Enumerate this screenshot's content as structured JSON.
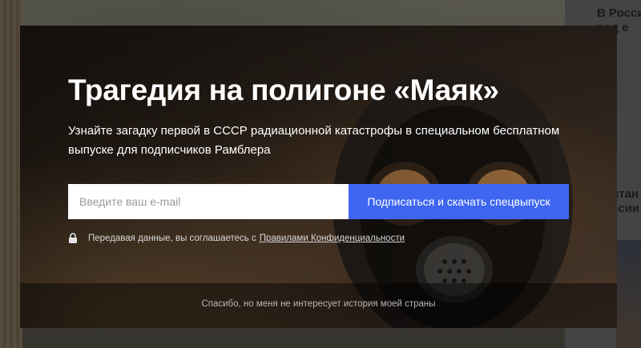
{
  "background": {
    "news_line_1": "В России",
    "news_line_2": "ред е",
    "news_line_3": "итан",
    "news_line_4": "ссии"
  },
  "modal": {
    "title": "Трагедия на полигоне «Маяк»",
    "subtitle": "Узнайте загадку первой в СССР радиационной катастрофы в специальном бесплатном выпуске для подписчиков Рамблера",
    "email_placeholder": "Введите ваш e-mail",
    "email_value": "",
    "submit_label": "Подписаться и скачать спецвыпуск",
    "privacy_text": "Передавая данные, вы соглашаетесь с",
    "privacy_link": "Правилами Конфиденциальности",
    "decline_label": "Спасибо, но меня не интересует история моей страны"
  },
  "icons": {
    "privacy": "lock-icon"
  },
  "colors": {
    "accent": "#3e66f0",
    "modal_bg": "#121212"
  }
}
